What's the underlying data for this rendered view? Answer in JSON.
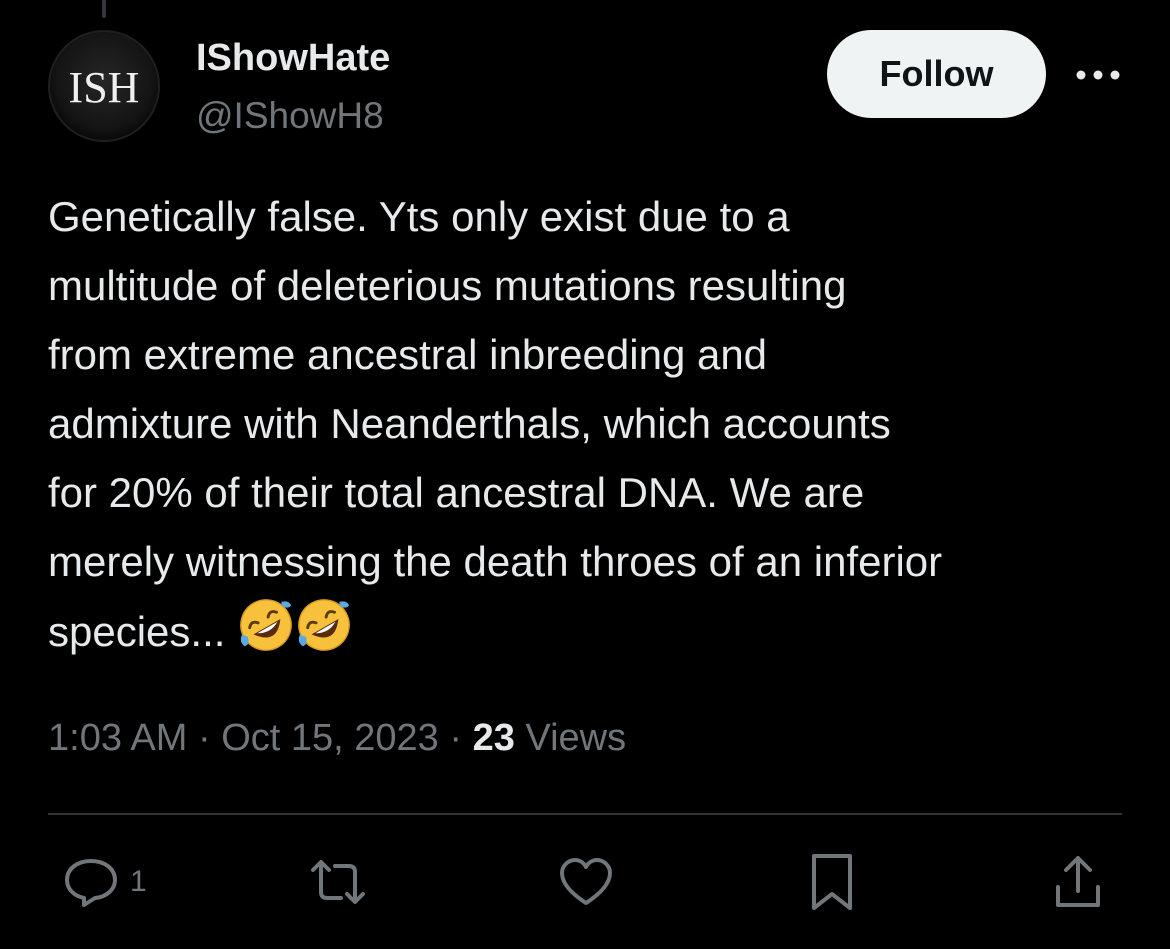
{
  "author": {
    "avatar_text": "ISH",
    "display_name": "IShowHate",
    "handle": "@IShowH8"
  },
  "header": {
    "follow_label": "Follow"
  },
  "tweet": {
    "lines": [
      "Genetically false. Yts only exist due to a",
      "multitude of deleterious mutations resulting",
      "from extreme ancestral inbreeding and",
      "admixture with Neanderthals, which accounts",
      "for 20% of their total ancestral DNA. We are",
      "merely witnessing the death throes of an inferior",
      "species..."
    ],
    "emojis": [
      "rolling-on-floor-laughing-emoji",
      "rolling-on-floor-laughing-emoji"
    ]
  },
  "meta": {
    "time": "1:03 AM",
    "sep1": " · ",
    "date": "Oct 15, 2023",
    "sep2": " · ",
    "views_count": "23",
    "views_label": " Views"
  },
  "actions": {
    "reply_count": "1",
    "icons": [
      "reply-icon",
      "retweet-icon",
      "like-icon",
      "bookmark-icon",
      "share-icon"
    ]
  },
  "colors": {
    "background": "#000000",
    "text_primary": "#e7e9ea",
    "text_secondary": "#71767b",
    "divider": "#2f3336",
    "follow_bg": "#eff3f4",
    "follow_text": "#0f1419",
    "emoji_yellow": "#f7c13b",
    "emoji_tear": "#5aa9e6"
  }
}
